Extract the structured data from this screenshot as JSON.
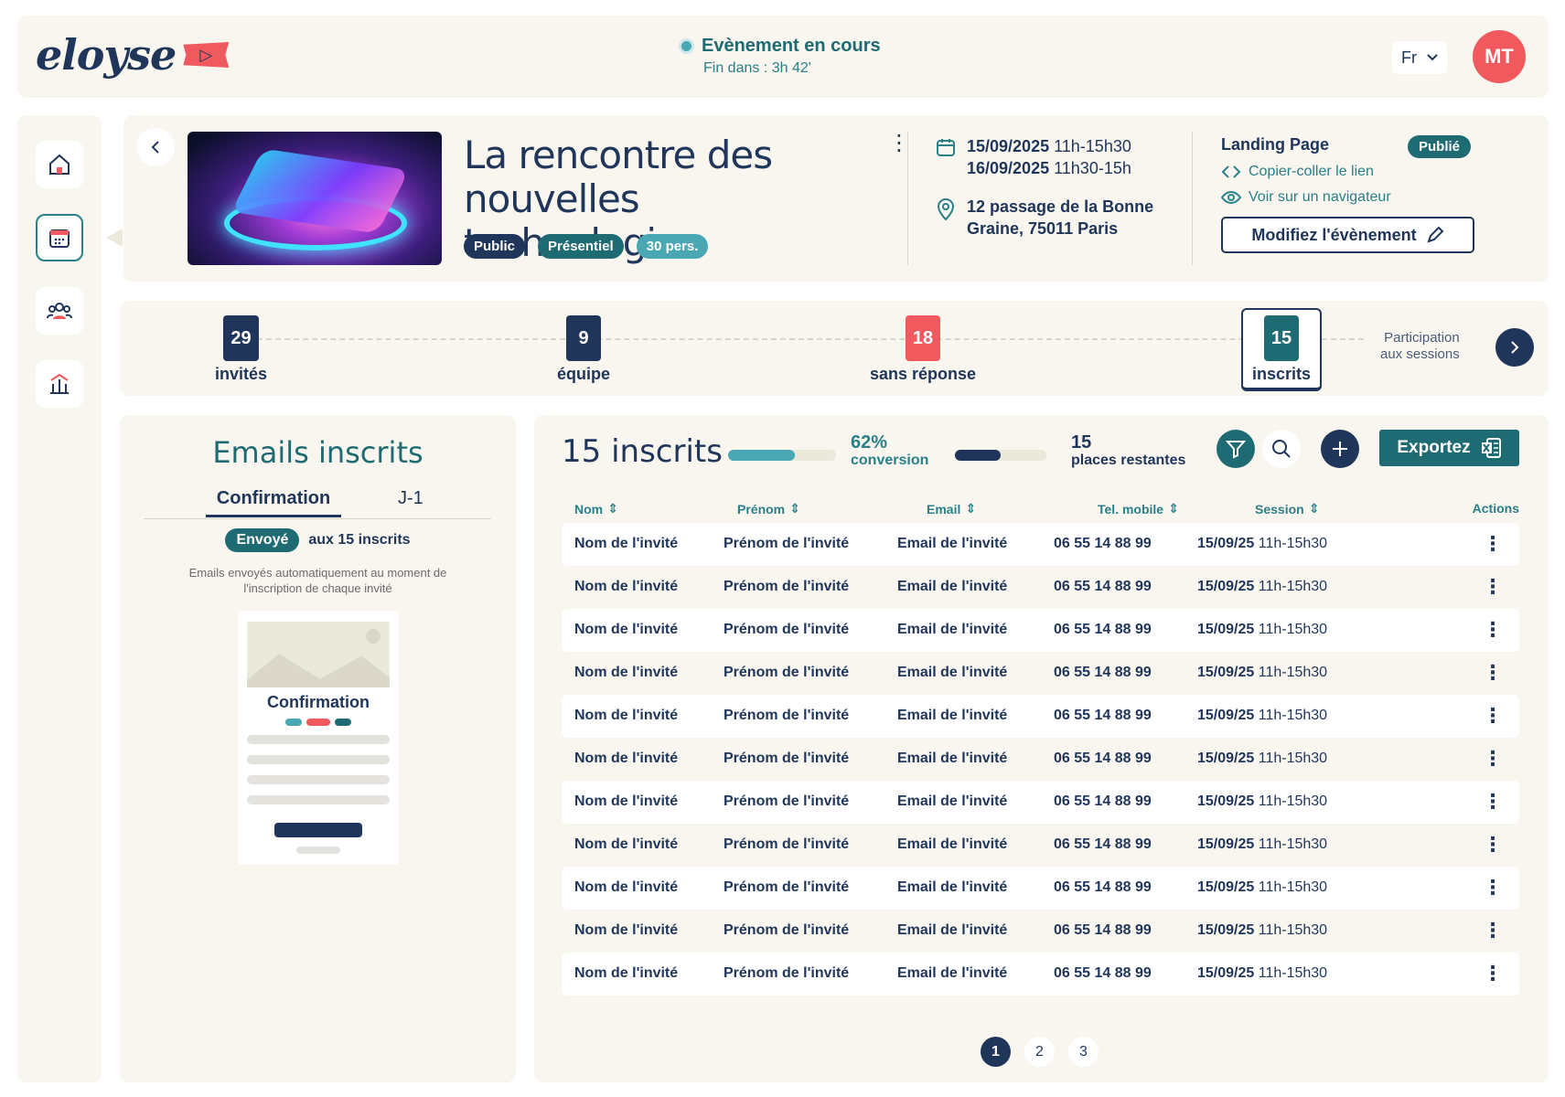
{
  "header": {
    "logo_text": "eloyse",
    "status_title": "Evènement en cours",
    "status_sub": "Fin dans : 3h 42'",
    "lang": "Fr",
    "avatar_initials": "MT"
  },
  "sidebar": {
    "items": [
      {
        "icon": "home-icon"
      },
      {
        "icon": "calendar-icon",
        "active": true
      },
      {
        "icon": "users-icon"
      },
      {
        "icon": "stats-icon"
      }
    ]
  },
  "event": {
    "title": "La rencontre des nouvelles technologies",
    "tags": [
      {
        "label": "Public",
        "color": "#1f3559"
      },
      {
        "label": "Présentiel",
        "color": "#1f6b73"
      },
      {
        "label": "30 pers.",
        "color": "#4aa8b4"
      }
    ],
    "dates": [
      {
        "day": "15/09/2025",
        "time": "11h-15h30"
      },
      {
        "day": "16/09/2025",
        "time": "11h30-15h"
      }
    ],
    "address": "12 passage de la Bonne Graine, 75011 Paris",
    "landing": {
      "title": "Landing Page",
      "badge": "Publié",
      "copy_link": "Copier-coller le lien",
      "view_link": "Voir sur un navigateur",
      "edit_button": "Modifiez l'évènement"
    }
  },
  "stats": {
    "items": [
      {
        "value": "29",
        "label": "invités",
        "color": "#1f3559"
      },
      {
        "value": "9",
        "label": "équipe",
        "color": "#1f3559"
      },
      {
        "value": "18",
        "label": "sans réponse",
        "color": "#f05a5e"
      },
      {
        "value": "15",
        "label": "inscrits",
        "color": "#1f6b73"
      }
    ],
    "participation_line1": "Participation",
    "participation_line2": "aux sessions"
  },
  "emails": {
    "title": "Emails inscrits",
    "tabs": [
      "Confirmation",
      "J-1"
    ],
    "sent_badge": "Envoyé",
    "sent_text": "aux 15 inscrits",
    "note": "Emails envoyés automatiquement au moment de l'inscription de chaque invité",
    "preview_title": "Confirmation"
  },
  "list": {
    "title": "15 inscrits",
    "conversion_value": "62%",
    "conversion_label": "conversion",
    "conversion_fraction": 0.62,
    "places_value": "15",
    "places_label": "places restantes",
    "places_fraction": 0.5,
    "export_label": "Exportez",
    "columns": [
      "Nom",
      "Prénom",
      "Email",
      "Tel. mobile",
      "Session",
      "Actions"
    ],
    "rows": [
      {
        "nom": "Nom de l'invité",
        "prenom": "Prénom de l'invité",
        "email": "Email de l'invité",
        "tel": "06 55 14 88 99",
        "session_date": "15/09/25",
        "session_time": "11h-15h30"
      },
      {
        "nom": "Nom de l'invité",
        "prenom": "Prénom de l'invité",
        "email": "Email de l'invité",
        "tel": "06 55 14 88 99",
        "session_date": "15/09/25",
        "session_time": "11h-15h30"
      },
      {
        "nom": "Nom de l'invité",
        "prenom": "Prénom de l'invité",
        "email": "Email de l'invité",
        "tel": "06 55 14 88 99",
        "session_date": "15/09/25",
        "session_time": "11h-15h30"
      },
      {
        "nom": "Nom de l'invité",
        "prenom": "Prénom de l'invité",
        "email": "Email de l'invité",
        "tel": "06 55 14 88 99",
        "session_date": "15/09/25",
        "session_time": "11h-15h30"
      },
      {
        "nom": "Nom de l'invité",
        "prenom": "Prénom de l'invité",
        "email": "Email de l'invité",
        "tel": "06 55 14 88 99",
        "session_date": "15/09/25",
        "session_time": "11h-15h30"
      },
      {
        "nom": "Nom de l'invité",
        "prenom": "Prénom de l'invité",
        "email": "Email de l'invité",
        "tel": "06 55 14 88 99",
        "session_date": "15/09/25",
        "session_time": "11h-15h30"
      },
      {
        "nom": "Nom de l'invité",
        "prenom": "Prénom de l'invité",
        "email": "Email de l'invité",
        "tel": "06 55 14 88 99",
        "session_date": "15/09/25",
        "session_time": "11h-15h30"
      },
      {
        "nom": "Nom de l'invité",
        "prenom": "Prénom de l'invité",
        "email": "Email de l'invité",
        "tel": "06 55 14 88 99",
        "session_date": "15/09/25",
        "session_time": "11h-15h30"
      },
      {
        "nom": "Nom de l'invité",
        "prenom": "Prénom de l'invité",
        "email": "Email de l'invité",
        "tel": "06 55 14 88 99",
        "session_date": "15/09/25",
        "session_time": "11h-15h30"
      },
      {
        "nom": "Nom de l'invité",
        "prenom": "Prénom de l'invité",
        "email": "Email de l'invité",
        "tel": "06 55 14 88 99",
        "session_date": "15/09/25",
        "session_time": "11h-15h30"
      },
      {
        "nom": "Nom de l'invité",
        "prenom": "Prénom de l'invité",
        "email": "Email de l'invité",
        "tel": "06 55 14 88 99",
        "session_date": "15/09/25",
        "session_time": "11h-15h30"
      }
    ],
    "pages": [
      "1",
      "2",
      "3"
    ],
    "current_page": "1"
  }
}
